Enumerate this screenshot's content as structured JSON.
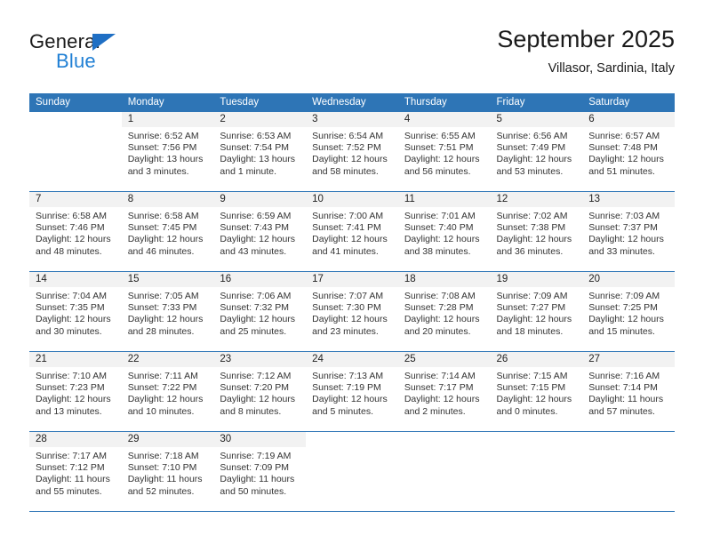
{
  "logo": {
    "word_one": "General",
    "word_two": "Blue",
    "icon": "triangle-flag-icon",
    "colors": {
      "blue": "#1f7fd4",
      "triangle": "#1f6fc4",
      "black": "#1a1a1a"
    }
  },
  "header": {
    "title": "September 2025",
    "subtitle": "Villasor, Sardinia, Italy"
  },
  "theme": {
    "header_blue": "#2e75b6",
    "daynum_band": "#f2f2f2",
    "text": "#333333"
  },
  "weekday_headers": [
    "Sunday",
    "Monday",
    "Tuesday",
    "Wednesday",
    "Thursday",
    "Friday",
    "Saturday"
  ],
  "weeks": [
    [
      {
        "day": "",
        "sunrise": "",
        "sunset": "",
        "daylight_line1": "",
        "daylight_line2": "",
        "empty": true
      },
      {
        "day": "1",
        "sunrise": "Sunrise: 6:52 AM",
        "sunset": "Sunset: 7:56 PM",
        "daylight_line1": "Daylight: 13 hours",
        "daylight_line2": "and 3 minutes."
      },
      {
        "day": "2",
        "sunrise": "Sunrise: 6:53 AM",
        "sunset": "Sunset: 7:54 PM",
        "daylight_line1": "Daylight: 13 hours",
        "daylight_line2": "and 1 minute."
      },
      {
        "day": "3",
        "sunrise": "Sunrise: 6:54 AM",
        "sunset": "Sunset: 7:52 PM",
        "daylight_line1": "Daylight: 12 hours",
        "daylight_line2": "and 58 minutes."
      },
      {
        "day": "4",
        "sunrise": "Sunrise: 6:55 AM",
        "sunset": "Sunset: 7:51 PM",
        "daylight_line1": "Daylight: 12 hours",
        "daylight_line2": "and 56 minutes."
      },
      {
        "day": "5",
        "sunrise": "Sunrise: 6:56 AM",
        "sunset": "Sunset: 7:49 PM",
        "daylight_line1": "Daylight: 12 hours",
        "daylight_line2": "and 53 minutes."
      },
      {
        "day": "6",
        "sunrise": "Sunrise: 6:57 AM",
        "sunset": "Sunset: 7:48 PM",
        "daylight_line1": "Daylight: 12 hours",
        "daylight_line2": "and 51 minutes."
      }
    ],
    [
      {
        "day": "7",
        "sunrise": "Sunrise: 6:58 AM",
        "sunset": "Sunset: 7:46 PM",
        "daylight_line1": "Daylight: 12 hours",
        "daylight_line2": "and 48 minutes."
      },
      {
        "day": "8",
        "sunrise": "Sunrise: 6:58 AM",
        "sunset": "Sunset: 7:45 PM",
        "daylight_line1": "Daylight: 12 hours",
        "daylight_line2": "and 46 minutes."
      },
      {
        "day": "9",
        "sunrise": "Sunrise: 6:59 AM",
        "sunset": "Sunset: 7:43 PM",
        "daylight_line1": "Daylight: 12 hours",
        "daylight_line2": "and 43 minutes."
      },
      {
        "day": "10",
        "sunrise": "Sunrise: 7:00 AM",
        "sunset": "Sunset: 7:41 PM",
        "daylight_line1": "Daylight: 12 hours",
        "daylight_line2": "and 41 minutes."
      },
      {
        "day": "11",
        "sunrise": "Sunrise: 7:01 AM",
        "sunset": "Sunset: 7:40 PM",
        "daylight_line1": "Daylight: 12 hours",
        "daylight_line2": "and 38 minutes."
      },
      {
        "day": "12",
        "sunrise": "Sunrise: 7:02 AM",
        "sunset": "Sunset: 7:38 PM",
        "daylight_line1": "Daylight: 12 hours",
        "daylight_line2": "and 36 minutes."
      },
      {
        "day": "13",
        "sunrise": "Sunrise: 7:03 AM",
        "sunset": "Sunset: 7:37 PM",
        "daylight_line1": "Daylight: 12 hours",
        "daylight_line2": "and 33 minutes."
      }
    ],
    [
      {
        "day": "14",
        "sunrise": "Sunrise: 7:04 AM",
        "sunset": "Sunset: 7:35 PM",
        "daylight_line1": "Daylight: 12 hours",
        "daylight_line2": "and 30 minutes."
      },
      {
        "day": "15",
        "sunrise": "Sunrise: 7:05 AM",
        "sunset": "Sunset: 7:33 PM",
        "daylight_line1": "Daylight: 12 hours",
        "daylight_line2": "and 28 minutes."
      },
      {
        "day": "16",
        "sunrise": "Sunrise: 7:06 AM",
        "sunset": "Sunset: 7:32 PM",
        "daylight_line1": "Daylight: 12 hours",
        "daylight_line2": "and 25 minutes."
      },
      {
        "day": "17",
        "sunrise": "Sunrise: 7:07 AM",
        "sunset": "Sunset: 7:30 PM",
        "daylight_line1": "Daylight: 12 hours",
        "daylight_line2": "and 23 minutes."
      },
      {
        "day": "18",
        "sunrise": "Sunrise: 7:08 AM",
        "sunset": "Sunset: 7:28 PM",
        "daylight_line1": "Daylight: 12 hours",
        "daylight_line2": "and 20 minutes."
      },
      {
        "day": "19",
        "sunrise": "Sunrise: 7:09 AM",
        "sunset": "Sunset: 7:27 PM",
        "daylight_line1": "Daylight: 12 hours",
        "daylight_line2": "and 18 minutes."
      },
      {
        "day": "20",
        "sunrise": "Sunrise: 7:09 AM",
        "sunset": "Sunset: 7:25 PM",
        "daylight_line1": "Daylight: 12 hours",
        "daylight_line2": "and 15 minutes."
      }
    ],
    [
      {
        "day": "21",
        "sunrise": "Sunrise: 7:10 AM",
        "sunset": "Sunset: 7:23 PM",
        "daylight_line1": "Daylight: 12 hours",
        "daylight_line2": "and 13 minutes."
      },
      {
        "day": "22",
        "sunrise": "Sunrise: 7:11 AM",
        "sunset": "Sunset: 7:22 PM",
        "daylight_line1": "Daylight: 12 hours",
        "daylight_line2": "and 10 minutes."
      },
      {
        "day": "23",
        "sunrise": "Sunrise: 7:12 AM",
        "sunset": "Sunset: 7:20 PM",
        "daylight_line1": "Daylight: 12 hours",
        "daylight_line2": "and 8 minutes."
      },
      {
        "day": "24",
        "sunrise": "Sunrise: 7:13 AM",
        "sunset": "Sunset: 7:19 PM",
        "daylight_line1": "Daylight: 12 hours",
        "daylight_line2": "and 5 minutes."
      },
      {
        "day": "25",
        "sunrise": "Sunrise: 7:14 AM",
        "sunset": "Sunset: 7:17 PM",
        "daylight_line1": "Daylight: 12 hours",
        "daylight_line2": "and 2 minutes."
      },
      {
        "day": "26",
        "sunrise": "Sunrise: 7:15 AM",
        "sunset": "Sunset: 7:15 PM",
        "daylight_line1": "Daylight: 12 hours",
        "daylight_line2": "and 0 minutes."
      },
      {
        "day": "27",
        "sunrise": "Sunrise: 7:16 AM",
        "sunset": "Sunset: 7:14 PM",
        "daylight_line1": "Daylight: 11 hours",
        "daylight_line2": "and 57 minutes."
      }
    ],
    [
      {
        "day": "28",
        "sunrise": "Sunrise: 7:17 AM",
        "sunset": "Sunset: 7:12 PM",
        "daylight_line1": "Daylight: 11 hours",
        "daylight_line2": "and 55 minutes."
      },
      {
        "day": "29",
        "sunrise": "Sunrise: 7:18 AM",
        "sunset": "Sunset: 7:10 PM",
        "daylight_line1": "Daylight: 11 hours",
        "daylight_line2": "and 52 minutes."
      },
      {
        "day": "30",
        "sunrise": "Sunrise: 7:19 AM",
        "sunset": "Sunset: 7:09 PM",
        "daylight_line1": "Daylight: 11 hours",
        "daylight_line2": "and 50 minutes."
      },
      {
        "day": "",
        "sunrise": "",
        "sunset": "",
        "daylight_line1": "",
        "daylight_line2": "",
        "empty": true
      },
      {
        "day": "",
        "sunrise": "",
        "sunset": "",
        "daylight_line1": "",
        "daylight_line2": "",
        "empty": true
      },
      {
        "day": "",
        "sunrise": "",
        "sunset": "",
        "daylight_line1": "",
        "daylight_line2": "",
        "empty": true
      },
      {
        "day": "",
        "sunrise": "",
        "sunset": "",
        "daylight_line1": "",
        "daylight_line2": "",
        "empty": true
      }
    ]
  ]
}
